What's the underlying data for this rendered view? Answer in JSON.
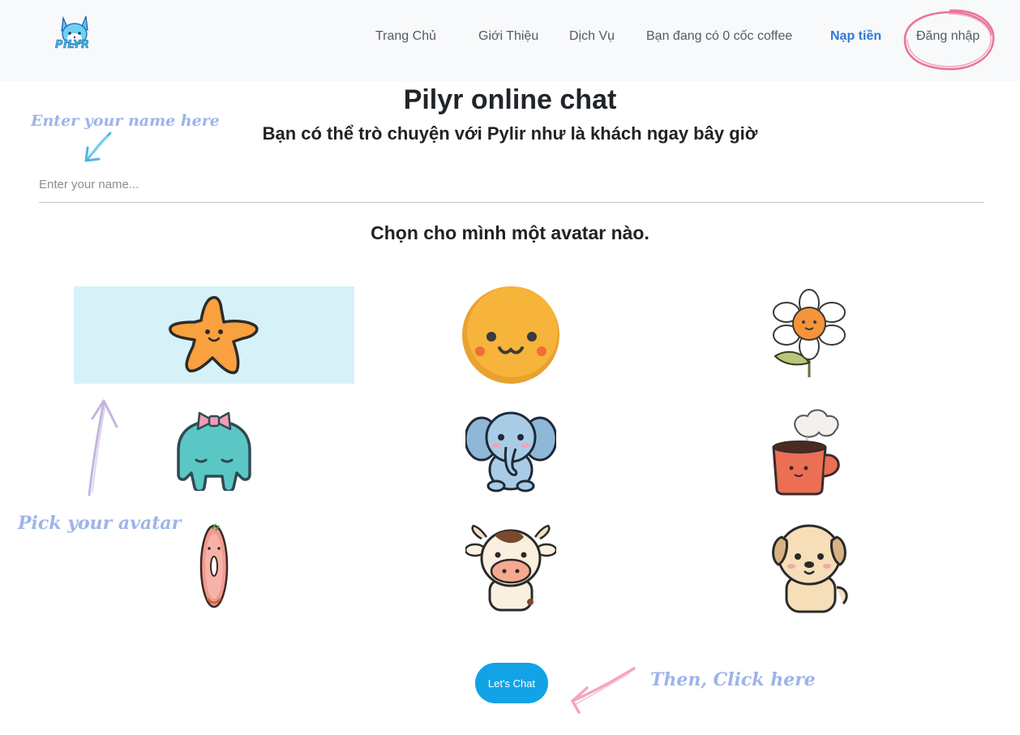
{
  "brand": {
    "logo_text": "PILYR",
    "logo_icon": "fox-mascot-icon"
  },
  "nav": {
    "home": "Trang Chủ",
    "about": "Giới Thiệu",
    "services": "Dịch Vụ",
    "coffee": "Bạn đang có 0 cốc coffee",
    "topup": "Nạp tiền",
    "login": "Đăng nhập"
  },
  "main": {
    "title": "Pilyr online chat",
    "subtitle": "Bạn có thể trò chuyện với Pylir như là khách ngay bây giờ",
    "name_placeholder": "Enter your name...",
    "name_value": "",
    "choose_avatar": "Chọn cho mình một avatar nào.",
    "chat_button": "Let's Chat"
  },
  "hints": {
    "name": "Enter your name here",
    "avatar": "Pick your avatar",
    "click": "Then, Click here"
  },
  "avatars": [
    {
      "icon": "starfish-icon",
      "selected": true
    },
    {
      "icon": "smiley-face-icon",
      "selected": false
    },
    {
      "icon": "flower-icon",
      "selected": false
    },
    {
      "icon": "ghost-bow-icon",
      "selected": false
    },
    {
      "icon": "elephant-icon",
      "selected": false
    },
    {
      "icon": "coffee-mug-icon",
      "selected": false
    },
    {
      "icon": "donut-icon",
      "selected": false
    },
    {
      "icon": "cow-icon",
      "selected": false
    },
    {
      "icon": "puppy-icon",
      "selected": false
    }
  ],
  "colors": {
    "navbar_bg": "#f8f9fa",
    "accent": "#2f7ad6",
    "button": "#12a3e6",
    "selected_bg": "#d7f1f8",
    "hint_text": "#9db4ea",
    "login_circle": "#e9759a"
  }
}
